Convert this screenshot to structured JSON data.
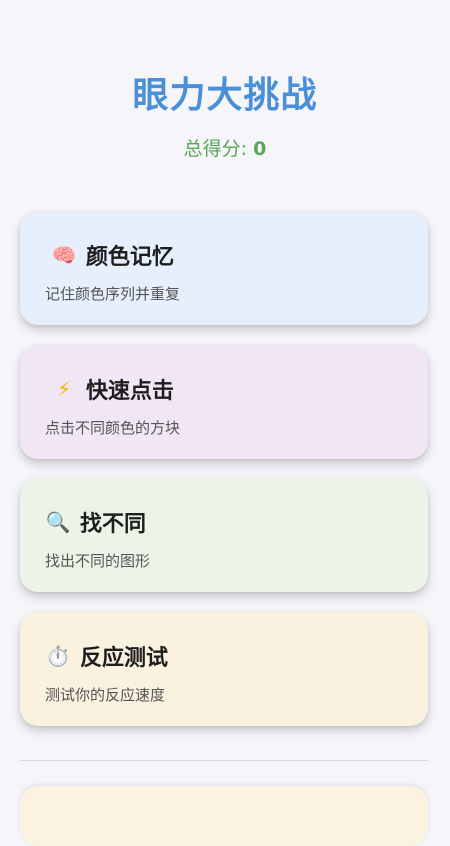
{
  "title": "眼力大挑战",
  "score": {
    "label": "总得分:",
    "value": "0"
  },
  "games": [
    {
      "icon": "brain-icon",
      "icon_glyph": "🧠",
      "title": "颜色记忆",
      "desc": "记住颜色序列并重复",
      "bg": "#e6effc"
    },
    {
      "icon": "lightning-icon",
      "icon_glyph": "⚡",
      "title": "快速点击",
      "desc": "点击不同颜色的方块",
      "bg": "#f1e6f3"
    },
    {
      "icon": "magnifier-icon",
      "icon_glyph": "🔍",
      "title": "找不同",
      "desc": "找出不同的图形",
      "bg": "#ebf4e7"
    },
    {
      "icon": "stopwatch-icon",
      "icon_glyph": "⏱️",
      "title": "反应测试",
      "desc": "测试你的反应速度",
      "bg": "#faf1de"
    }
  ],
  "colors": {
    "title": "#4a90d9",
    "score": "#5aa55a",
    "background": "#f6f5f9"
  }
}
